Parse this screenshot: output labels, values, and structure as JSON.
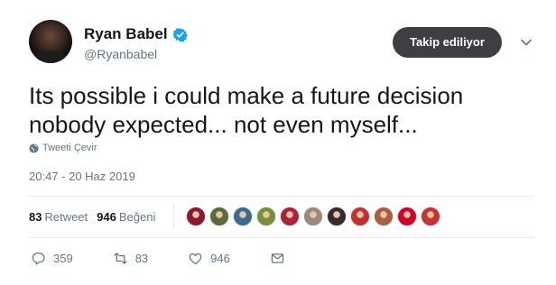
{
  "profile": {
    "display_name": "Ryan Babel",
    "handle": "@Ryanbabel",
    "verified": true
  },
  "follow_button_label": "Takip ediliyor",
  "tweet": {
    "text": "Its possible i could make a future decision nobody expected... not even myself...",
    "translate_label": "Tweeti Çevir",
    "timestamp": "20:47 - 20 Haz 2019"
  },
  "stats": {
    "retweet_count": "83",
    "retweet_label": "Retweet",
    "like_count": "946",
    "like_label": "Beğeni"
  },
  "likers": [
    {
      "icon": "liker-avatar",
      "color": "#8a1b2e"
    },
    {
      "icon": "liker-avatar",
      "color": "#5a6b3a"
    },
    {
      "icon": "liker-avatar",
      "color": "#3d6b8a"
    },
    {
      "icon": "liker-avatar",
      "color": "#7a8f3a"
    },
    {
      "icon": "liker-avatar",
      "color": "#b0203a"
    },
    {
      "icon": "liker-avatar",
      "color": "#9a8a78"
    },
    {
      "icon": "liker-avatar",
      "color": "#3a2a2a"
    },
    {
      "icon": "liker-avatar",
      "color": "#c43030"
    },
    {
      "icon": "liker-avatar",
      "color": "#a86040"
    },
    {
      "icon": "liverpool-crest-icon",
      "color": "#d00027"
    },
    {
      "icon": "liker-avatar",
      "color": "#c83232"
    }
  ],
  "actions": {
    "reply_count": "359",
    "retweet_count": "83",
    "like_count": "946"
  },
  "colors": {
    "text_primary": "#14171a",
    "text_secondary": "#657786",
    "verified_blue": "#1da1f2",
    "follow_button_bg": "#3d3f42",
    "divider": "#e6ecf0"
  }
}
